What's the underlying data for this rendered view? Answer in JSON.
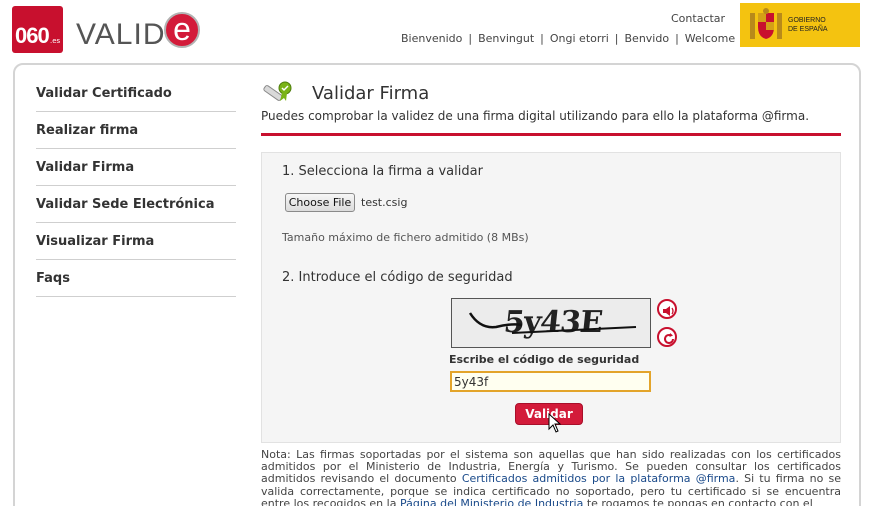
{
  "header": {
    "logo_060": "060",
    "logo_060_suffix": ".es",
    "logo_valid": "VALID",
    "logo_e": "e",
    "contact_link": "Contactar",
    "languages": [
      "Bienvenido",
      "Benvingut",
      "Ongi etorri",
      "Benvido",
      "Welcome"
    ],
    "gov_logo_line1": "GOBIERNO",
    "gov_logo_line2": "DE ESPAÑA"
  },
  "sidebar": {
    "items": [
      {
        "label": "Validar Certificado"
      },
      {
        "label": "Realizar firma"
      },
      {
        "label": "Validar Firma"
      },
      {
        "label": "Validar Sede Electrónica"
      },
      {
        "label": "Visualizar Firma"
      },
      {
        "label": "Faqs"
      }
    ]
  },
  "main": {
    "title": "Validar Firma",
    "subtitle": "Puedes comprobar la validez de una firma digital utilizando para ello la plataforma @firma.",
    "step1_label": "1. Selecciona la firma a validar",
    "file_button": "Choose File",
    "file_name": "test.csig",
    "max_size": "Tamaño máximo de fichero admitido (8 MBs)",
    "step2_label": "2. Introduce el código de seguridad",
    "captcha_text": "5y43E",
    "code_label": "Escribe el código de seguridad",
    "code_value": "5y43f",
    "submit_label": "Validar",
    "note_part1": "Nota: Las firmas soportadas por el sistema son aquellas que han sido realizadas con los certificados admitidos por el Ministerio de Industria, Energía y Turismo. Se pueden consultar los certificados admitidos revisando el documento ",
    "note_link1": "Certificados admitidos por la plataforma @firma",
    "note_part2": ". Si tu firma no se valida correctamente, porque se indica certificado no soportado, pero tu certificado si se encuentra entre los recogidos en la ",
    "note_link2": "Página del Ministerio de Industria",
    "note_part3": " te rogamos te pongas en contacto con el"
  },
  "colors": {
    "brand_red": "#c8102e",
    "gov_yellow": "#f4c310",
    "input_border": "#e3a42a"
  }
}
